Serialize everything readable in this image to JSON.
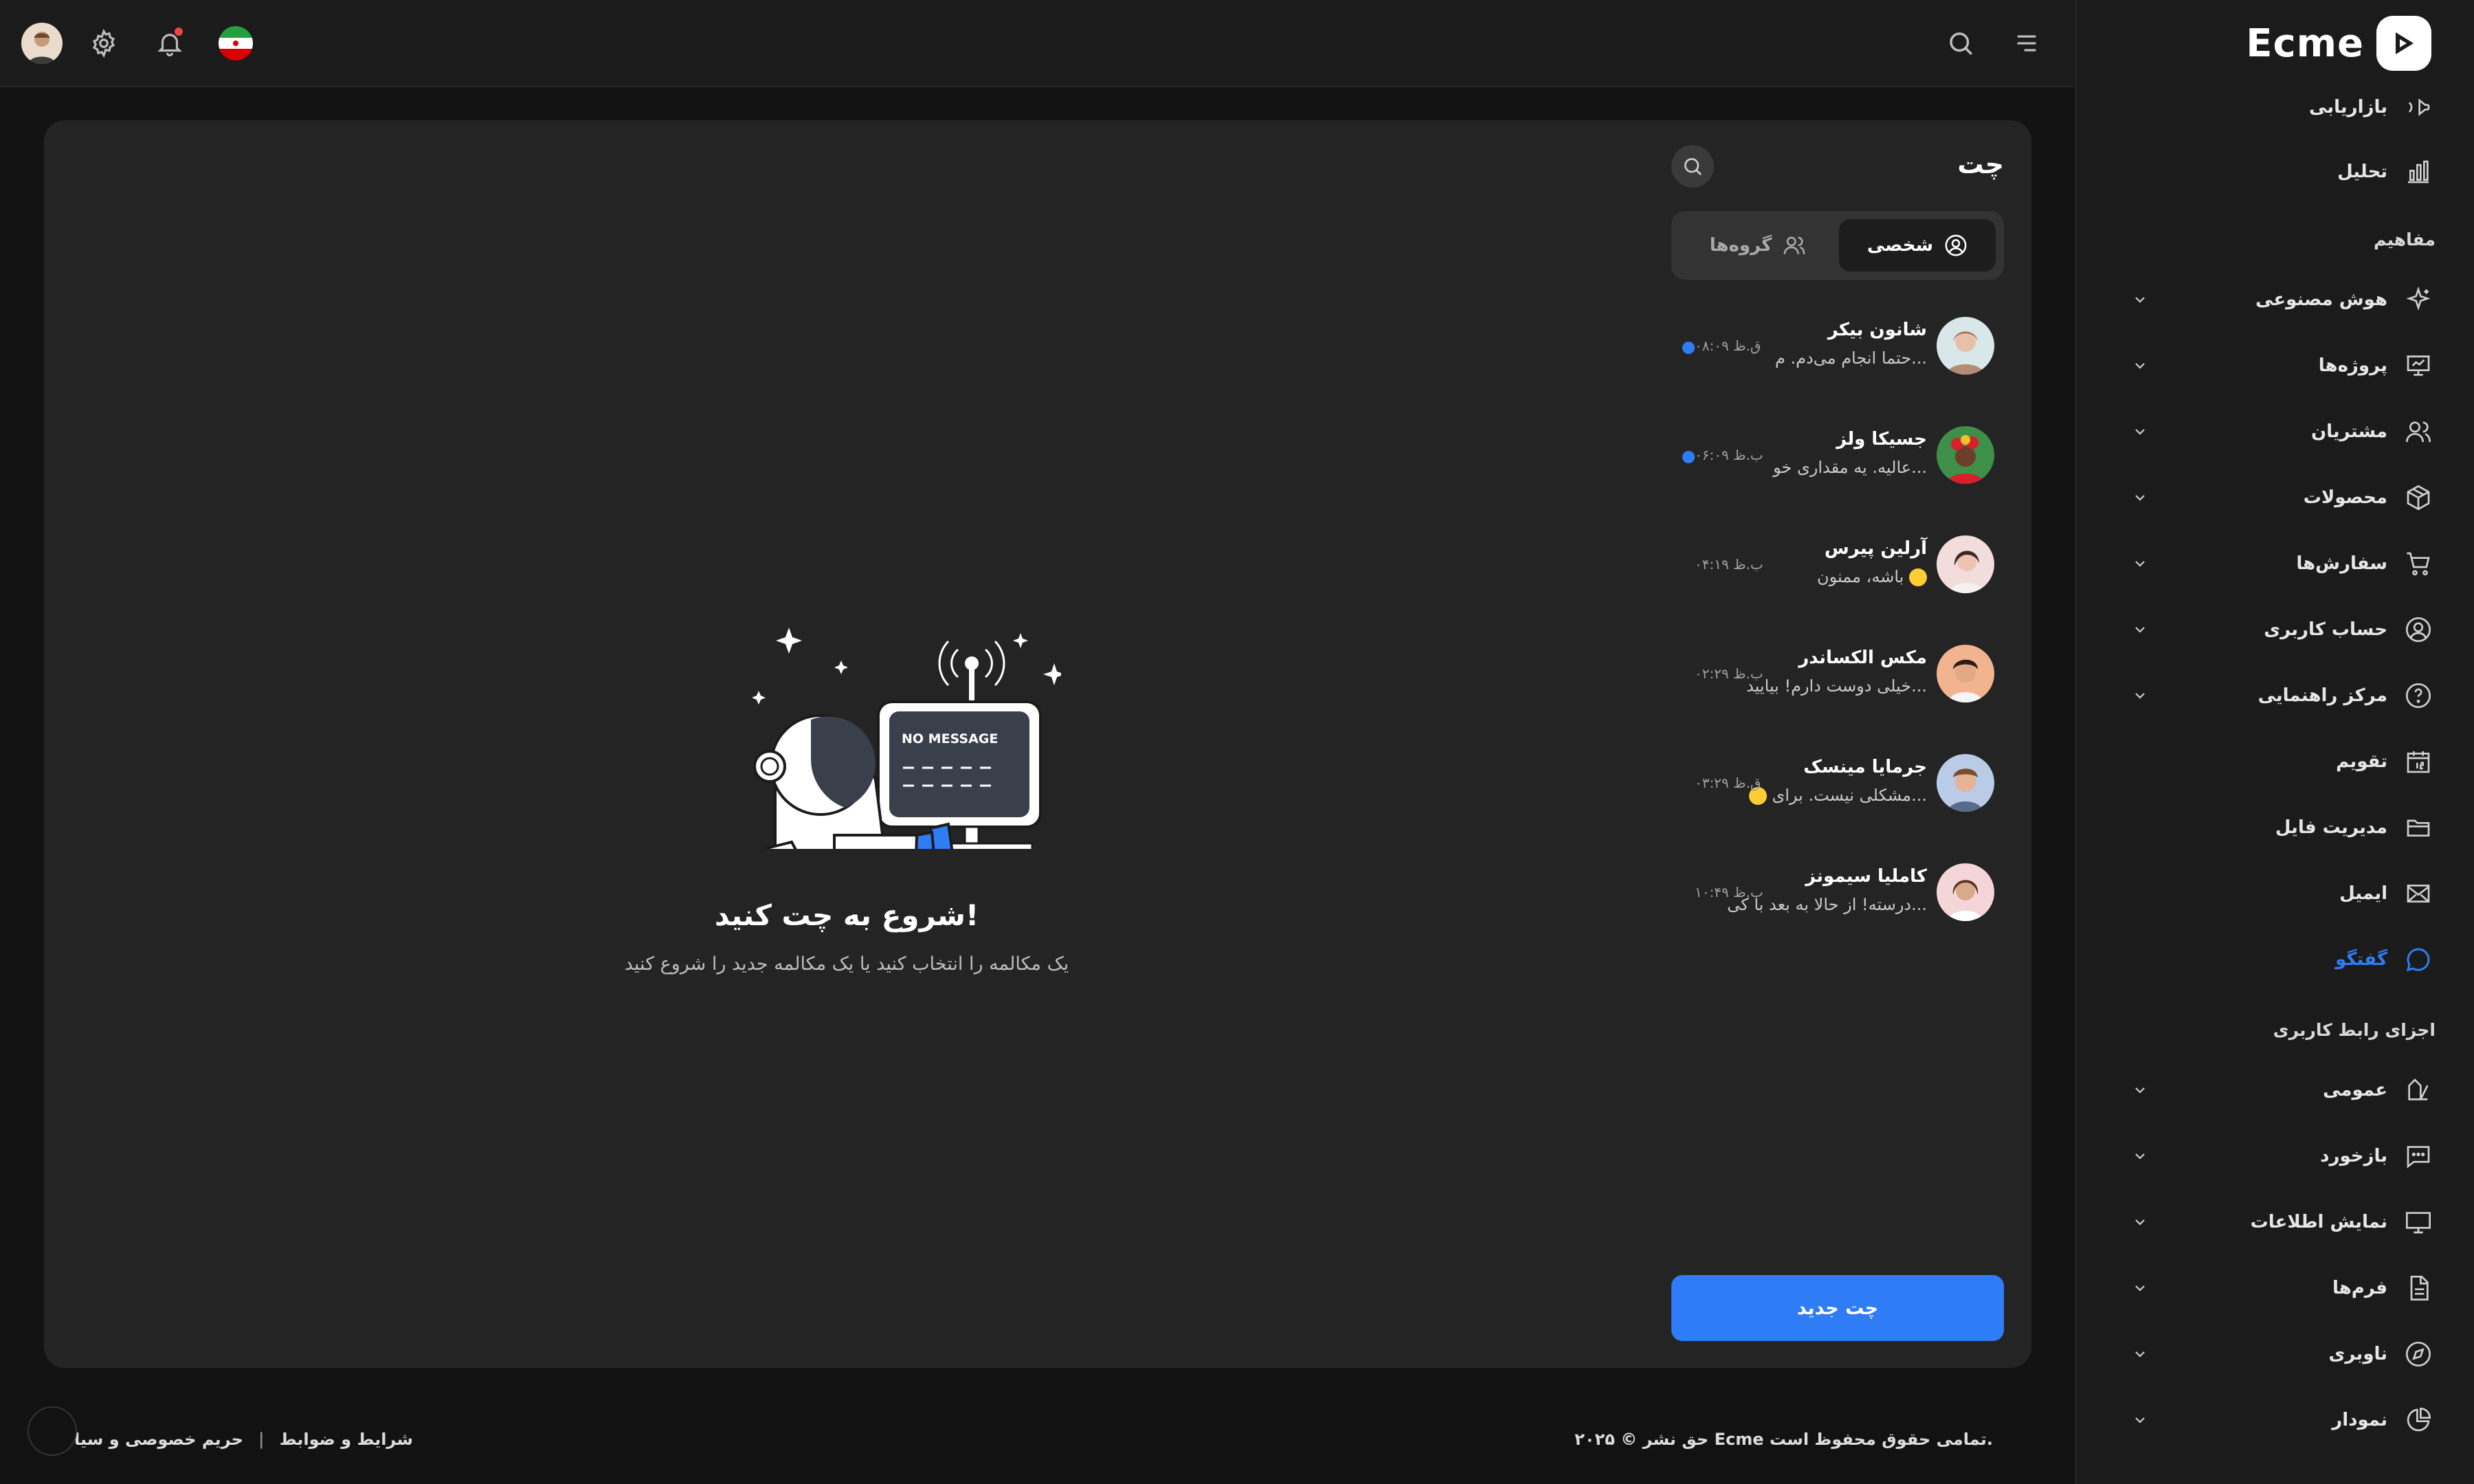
{
  "brand": {
    "name": "Ecme",
    "accent": "#2f7df6"
  },
  "sidebar": {
    "items": [
      {
        "label": "بازاریابی",
        "icon": "megaphone-icon"
      },
      {
        "label": "تحلیل",
        "icon": "bar-chart-icon"
      }
    ],
    "sections": [
      {
        "title": "مفاهیم",
        "items": [
          {
            "label": "هوش مصنوعی",
            "icon": "sparkles-icon",
            "expandable": true
          },
          {
            "label": "پروژه‌ها",
            "icon": "presentation-icon",
            "expandable": true
          },
          {
            "label": "مشتریان",
            "icon": "users-icon",
            "expandable": true
          },
          {
            "label": "محصولات",
            "icon": "box-icon",
            "expandable": true
          },
          {
            "label": "سفارش‌ها",
            "icon": "cart-icon",
            "expandable": true
          },
          {
            "label": "حساب کاربری",
            "icon": "user-circle-icon",
            "expandable": true
          },
          {
            "label": "مرکز راهنمایی",
            "icon": "help-icon",
            "expandable": true
          },
          {
            "label": "تقویم",
            "icon": "calendar-icon",
            "expandable": false
          },
          {
            "label": "مدیریت فایل",
            "icon": "folder-icon",
            "expandable": false
          },
          {
            "label": "ایمیل",
            "icon": "mail-icon",
            "expandable": false
          },
          {
            "label": "گفتگو",
            "icon": "chat-icon",
            "expandable": false,
            "active": true
          }
        ]
      },
      {
        "title": "اجزای رابط کاربری",
        "items": [
          {
            "label": "عمومی",
            "icon": "shapes-icon",
            "expandable": true
          },
          {
            "label": "بازخورد",
            "icon": "message-dots-icon",
            "expandable": true
          },
          {
            "label": "نمایش اطلاعات",
            "icon": "monitor-icon",
            "expandable": true
          },
          {
            "label": "فرم‌ها",
            "icon": "document-icon",
            "expandable": true
          },
          {
            "label": "ناوبری",
            "icon": "compass-icon",
            "expandable": true
          },
          {
            "label": "نمودار",
            "icon": "pie-chart-icon",
            "expandable": true
          }
        ]
      }
    ]
  },
  "header": {
    "icons": [
      "menu-icon",
      "search-icon",
      "flag-iran-icon",
      "bell-icon",
      "gear-icon",
      "avatar"
    ]
  },
  "chat": {
    "title": "چت",
    "tabs": [
      {
        "label": "شخصی",
        "active": true
      },
      {
        "label": "گروه‌ها",
        "active": false
      }
    ],
    "conversations": [
      {
        "name": "شانون بیکر",
        "message": "حتما انجام می‌دم. م...",
        "time": "۰۸:۰۹ ق.ظ",
        "unread": true,
        "color": "#d8b4a0"
      },
      {
        "name": "جسیکا ولز",
        "message": "عالیه. یه مقداری خو...",
        "time": "۰۶:۰۹ ب.ظ",
        "unread": true,
        "color": "#6b3f2a"
      },
      {
        "name": "آرلین پیرس",
        "message": "باشه، ممنون",
        "time": "۰۴:۱۹ ب.ظ",
        "unread": false,
        "emoji": true,
        "color": "#e9c8c0"
      },
      {
        "name": "مکس الکساندر",
        "message": "خیلی دوست دارم! بیایید...",
        "time": "۰۲:۲۹ ب.ظ",
        "unread": false,
        "color": "#c98b66"
      },
      {
        "name": "جرمایا مینسک",
        "message": "مشکلی نیست. برای...",
        "time": "۰۳:۲۹ ق.ظ",
        "unread": false,
        "emoji": true,
        "color": "#c99577"
      },
      {
        "name": "کاملیا سیمونز",
        "message": "درسته! از حالا به بعد با کی...",
        "time": "۱۰:۴۹ ب.ظ",
        "unread": false,
        "color": "#d9a98c"
      }
    ],
    "new_chat_label": "چت جدید",
    "empty": {
      "title": "شروع به چت کنید!",
      "subtitle": "یک مکالمه را انتخاب کنید یا یک مکالمه جدید را شروع کنید",
      "screen_text": "NO MESSAGE"
    }
  },
  "footer": {
    "copyright": "حق نشر © ۲۰۲۵ Ecme تمامی حقوق محفوظ است.",
    "terms": "شرایط و ضوابط",
    "separator": "|",
    "privacy": "حریم خصوصی و سیا"
  }
}
